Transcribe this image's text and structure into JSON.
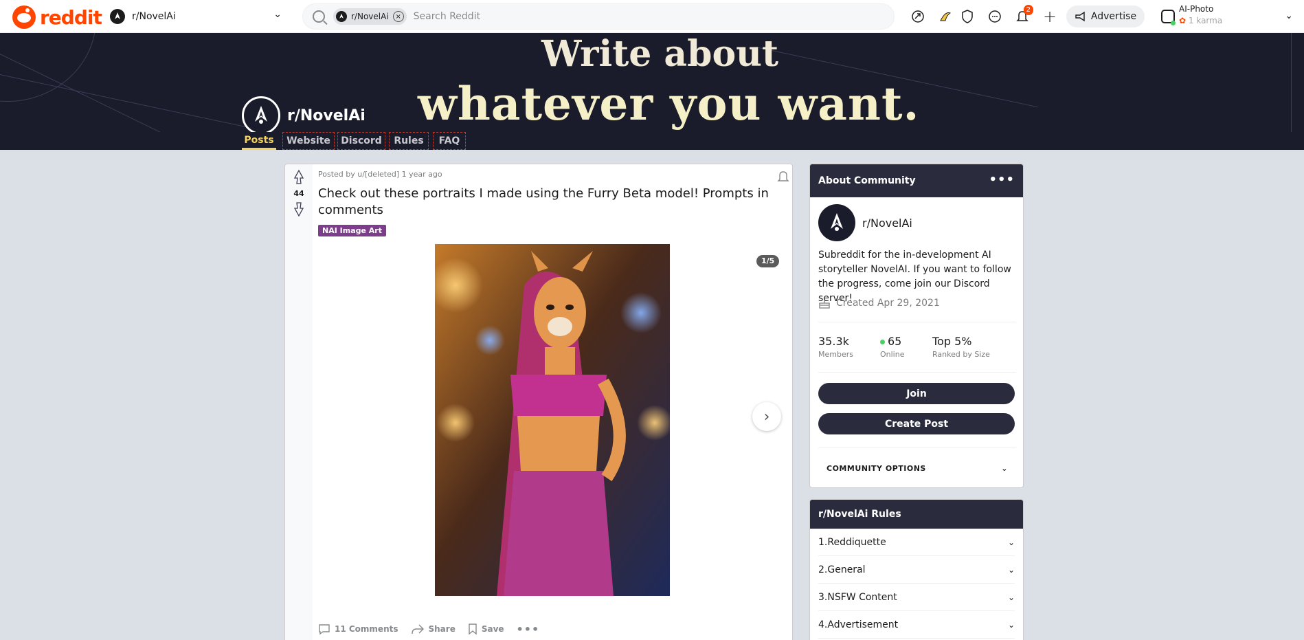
{
  "header": {
    "logo_text": "reddit",
    "community_selector": "r/NovelAi",
    "search_chip": "r/NovelAi",
    "search_placeholder": "Search Reddit",
    "notification_count": "2",
    "advertise_label": "Advertise",
    "username": "AI-Photo",
    "karma": "1 karma"
  },
  "banner": {
    "line1": "Write about",
    "line2": "whatever you want.",
    "subreddit_name": "r/NovelAi"
  },
  "nav": {
    "tabs": [
      {
        "label": "Posts",
        "active": true
      },
      {
        "label": "Website"
      },
      {
        "label": "Discord"
      },
      {
        "label": "Rules"
      },
      {
        "label": "FAQ"
      }
    ]
  },
  "post": {
    "meta": "Posted by u/[deleted] 1 year ago",
    "score": "44",
    "title": "Check out these portraits I made using the Furry Beta model! Prompts in comments",
    "flair": "NAI Image Art",
    "pager": "1/5",
    "comments_label": "11 Comments",
    "share_label": "Share",
    "save_label": "Save"
  },
  "about": {
    "heading": "About Community",
    "name": "r/NovelAi",
    "description": "Subreddit for the in-development AI storyteller NovelAI. If you want to follow the progress, come join our Discord server!",
    "created": "Created Apr 29, 2021",
    "members_value": "35.3k",
    "members_label": "Members",
    "online_value": "65",
    "online_label": "Online",
    "rank_value": "Top 5%",
    "rank_label": "Ranked by Size",
    "join_label": "Join",
    "create_post_label": "Create Post",
    "community_options_label": "COMMUNITY OPTIONS"
  },
  "rules": {
    "heading": "r/NovelAi Rules",
    "items": [
      {
        "num": "1.",
        "label": "Reddiquette"
      },
      {
        "num": "2.",
        "label": "General"
      },
      {
        "num": "3.",
        "label": "NSFW Content"
      },
      {
        "num": "4.",
        "label": "Advertisement"
      }
    ]
  },
  "colors": {
    "brand": "#ff4500",
    "banner_bg": "#1b1c2b",
    "accent_yellow": "#f4d45e",
    "flair": "#7c3d8b",
    "online_green": "#46d160"
  }
}
